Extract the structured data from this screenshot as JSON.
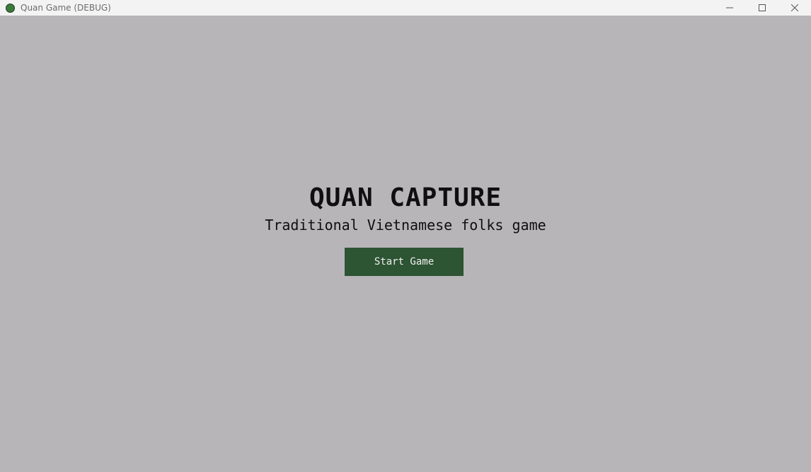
{
  "window": {
    "title": "Quan Game (DEBUG)",
    "controls": [
      "minimize-icon",
      "maximize-icon",
      "close-icon"
    ]
  },
  "menu": {
    "title": "QUAN CAPTURE",
    "subtitle": "Traditional Vietnamese folks game",
    "start_label": "Start Game"
  },
  "colors": {
    "background": "#b7b5b8",
    "button": "#2d5433",
    "app_icon": "#3a7a3a",
    "titlebar": "#f3f3f3"
  }
}
